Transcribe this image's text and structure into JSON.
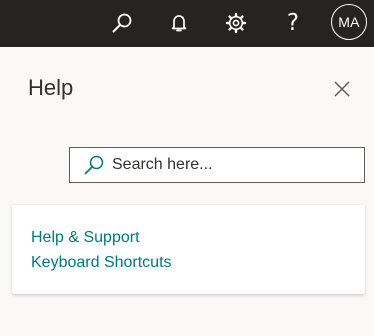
{
  "header": {
    "icons": [
      "search-icon",
      "bell-icon",
      "gear-icon",
      "question-icon"
    ],
    "help_glyph": "?",
    "avatar_initials": "MA",
    "background": "#252423"
  },
  "panel": {
    "title": "Help",
    "close_icon": "close-icon",
    "search": {
      "placeholder": "Search here...",
      "value": ""
    },
    "links": [
      {
        "label": "Help & Support"
      },
      {
        "label": "Keyboard Shortcuts"
      }
    ],
    "link_color": "#03787c"
  }
}
